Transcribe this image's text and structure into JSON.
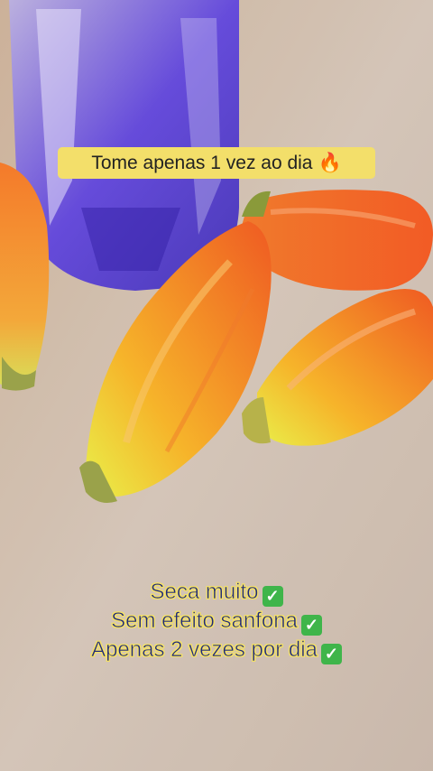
{
  "captions": {
    "top_text": "Tome apenas 1 vez ao dia",
    "top_emoji": "🔥",
    "lines": [
      {
        "text": "Seca muito",
        "emoji": "✅"
      },
      {
        "text": "Sem efeito sanfona",
        "emoji": "✅"
      },
      {
        "text": "Apenas 2 vezes por dia",
        "emoji": "✅"
      }
    ]
  },
  "colors": {
    "caption_background": "#f3df6a",
    "caption_text": "#1f2a7a",
    "check": "#3fb54a"
  }
}
